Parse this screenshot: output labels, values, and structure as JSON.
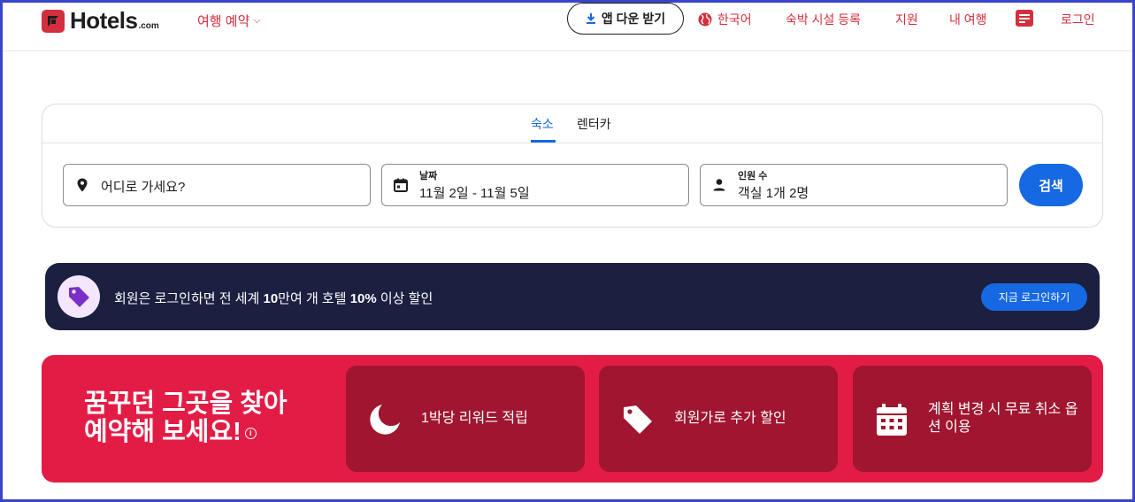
{
  "header": {
    "logo_text": "Hotels",
    "logo_suffix": ".com",
    "trip_menu": "여행 예약",
    "app_button": "앱 다운 받기",
    "language": "한국어",
    "list_property": "숙박 시설 등록",
    "support": "지원",
    "my_trips": "내 여행",
    "login": "로그인"
  },
  "search": {
    "tabs": [
      "숙소",
      "렌터카"
    ],
    "destination_placeholder": "어디로 가세요?",
    "dates_label": "날짜",
    "dates_value": "11월 2일 - 11월 5일",
    "guests_label": "인원 수",
    "guests_value": "객실 1개 2명",
    "search_button": "검색"
  },
  "member_banner": {
    "text_1": "회원은 로그인하면 전 세계 ",
    "text_bold_1": "10",
    "text_2": "만여 개 호텔 ",
    "text_bold_2": "10%",
    "text_3": " 이상 할인",
    "button": "지금 로그인하기"
  },
  "promo": {
    "title_line1": "꿈꾸던 그곳을 찾아",
    "title_line2": "예약해 보세요!",
    "perks": [
      {
        "icon": "moon-icon",
        "text": "1박당 리워드 적립"
      },
      {
        "icon": "tag-icon",
        "text": "회원가로 추가 할인"
      },
      {
        "icon": "calendar-icon",
        "text": "계획 변경 시 무료 취소 옵션 이용"
      }
    ]
  },
  "colors": {
    "brand_red": "#d32f3f",
    "accent_blue": "#1668e3",
    "banner_navy": "#1b2041",
    "promo_red": "#e31c46",
    "perk_dark_red": "#a0152f"
  }
}
